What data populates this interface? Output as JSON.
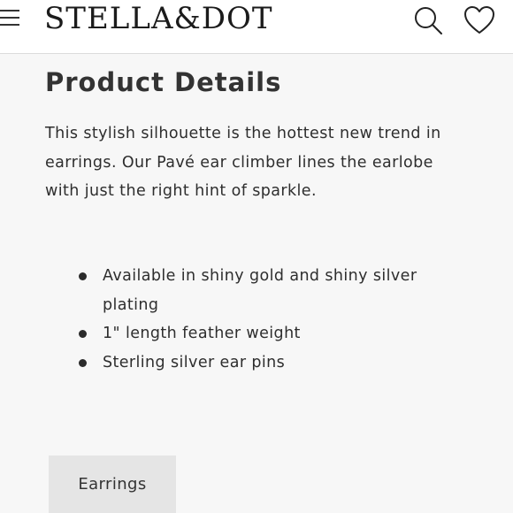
{
  "header": {
    "logo_text": "STELLA&DOT",
    "menu_icon": "hamburger-menu-icon",
    "search_icon": "search-icon",
    "wishlist_icon": "heart-icon"
  },
  "product_details": {
    "title": "Product Details",
    "description_lines": [
      "This stylish silhouette is the hottest new trend in",
      "earrings. Our Pavé ear climber lines the earlobe",
      "with just the right hint of sparkle."
    ],
    "features": [
      {
        "lines": [
          "Available in shiny gold and shiny silver",
          "plating"
        ]
      },
      {
        "lines": [
          "1\" length feather weight"
        ]
      },
      {
        "lines": [
          "Sterling silver ear pins"
        ]
      }
    ]
  },
  "category_tag": {
    "label": "Earrings"
  }
}
